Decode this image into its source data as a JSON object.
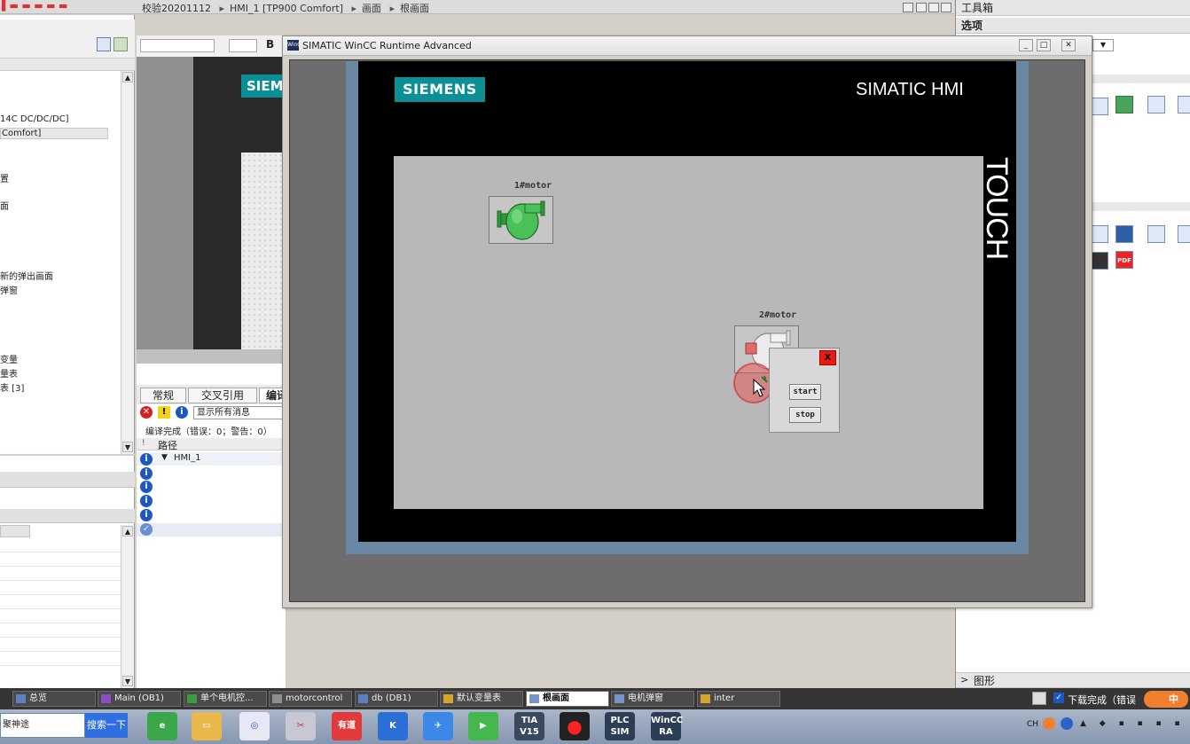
{
  "ide": {
    "title_project": "校验20201112",
    "title_crumbs": [
      "HMI_1 [TP900 Comfort]",
      "画面",
      "根画面"
    ]
  },
  "project_tree": {
    "items": [
      "14C DC/DC/DC]",
      "Comfort]",
      "置",
      "面",
      "新的弹出画面",
      "弹窗",
      "变量",
      "量表",
      "表 [3]"
    ],
    "selected_index": 1
  },
  "editor_toolbar": {
    "bold_label": "B"
  },
  "compile_panel": {
    "tabs": [
      "常规",
      "交叉引用",
      "编译"
    ],
    "active_tab": 2,
    "filter_label": "显示所有消息",
    "status": "编译完成（错误：0；警告：0）",
    "column_path": "路径",
    "row_path": "HMI_1"
  },
  "toolbox": {
    "title": "工具箱",
    "options_label": "选项",
    "graphics_label": "图形"
  },
  "runtime": {
    "window_title": "SIMATIC WinCC Runtime Advanced",
    "app_icon_text": "WinCC",
    "controls": {
      "min": "_",
      "max": "□",
      "close": "✕"
    },
    "brand_logo": "SIEMENS",
    "brand_model": "SIMATIC HMI",
    "touch_label": "TOUCH",
    "motors": [
      {
        "name": "1#motor",
        "state": "running"
      },
      {
        "name": "2#motor",
        "state": "stopped"
      }
    ],
    "popup": {
      "close_label": "X",
      "start_label": "start",
      "stop_label": "stop"
    }
  },
  "editor_tabs": [
    {
      "label": "总览"
    },
    {
      "label": "Main (OB1)"
    },
    {
      "label": "单个电机控..."
    },
    {
      "label": "motorcontrol"
    },
    {
      "label": "db (DB1)"
    },
    {
      "label": "默认变量表"
    },
    {
      "label": "根画面",
      "active": true
    },
    {
      "label": "电机弹窗"
    },
    {
      "label": "inter"
    }
  ],
  "status_right": "下载完成（错误",
  "taskbar": {
    "search_value": "聚神途",
    "search_button": "搜索一下",
    "apps": [
      "e-icon",
      "folder-icon",
      "baidu-icon",
      "paint-icon",
      "有道",
      "K",
      "bird-icon",
      "play-icon",
      "TIA V15",
      "record-icon",
      "PLC SIM",
      "WinCC RA"
    ],
    "tray_text": "CH",
    "ime_text": "中"
  },
  "colors": {
    "siemens_teal": "#0b9096",
    "motor_running": "#3ebd4a",
    "motor_stopped": "#e0e0e0",
    "popup_close": "#e81a12",
    "touch_indicator": "#f04646"
  }
}
